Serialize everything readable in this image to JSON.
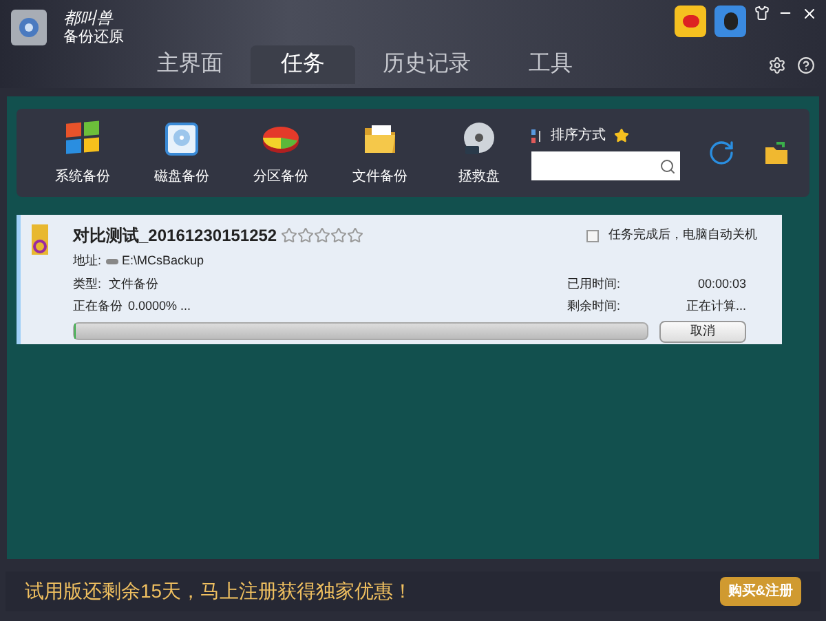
{
  "app": {
    "brand": "都叫兽",
    "product": "备份还原"
  },
  "tabs": [
    {
      "label": "主界面",
      "selected": false
    },
    {
      "label": "任务",
      "selected": true
    },
    {
      "label": "历史记录",
      "selected": false
    },
    {
      "label": "工具",
      "selected": false
    }
  ],
  "toolbar": [
    {
      "label": "系统备份",
      "kind": "windows"
    },
    {
      "label": "磁盘备份",
      "kind": "disk"
    },
    {
      "label": "分区备份",
      "kind": "pie"
    },
    {
      "label": "文件备份",
      "kind": "folder"
    },
    {
      "label": "拯救盘",
      "kind": "cd"
    }
  ],
  "sort": {
    "label": "排序方式"
  },
  "task": {
    "title": "对比测试_20161230151252",
    "stars": 0,
    "shutdown": {
      "label": "任务完成后，电脑自动关机",
      "checked": false
    },
    "address_label": "地址:",
    "address": "E:\\MCsBackup",
    "type_label": "类型:",
    "type": "文件备份",
    "status_label": "正在备份",
    "percent": "0.0000% ...",
    "elapsed_label": "已用时间:",
    "elapsed": "00:00:03",
    "remaining_label": "剩余时间:",
    "remaining": "正在计算...",
    "level": 0,
    "cancel": "取消"
  },
  "footer": {
    "message": "试用版还剩余15天，马上注册获得独家优惠！",
    "button": "购买&注册"
  }
}
